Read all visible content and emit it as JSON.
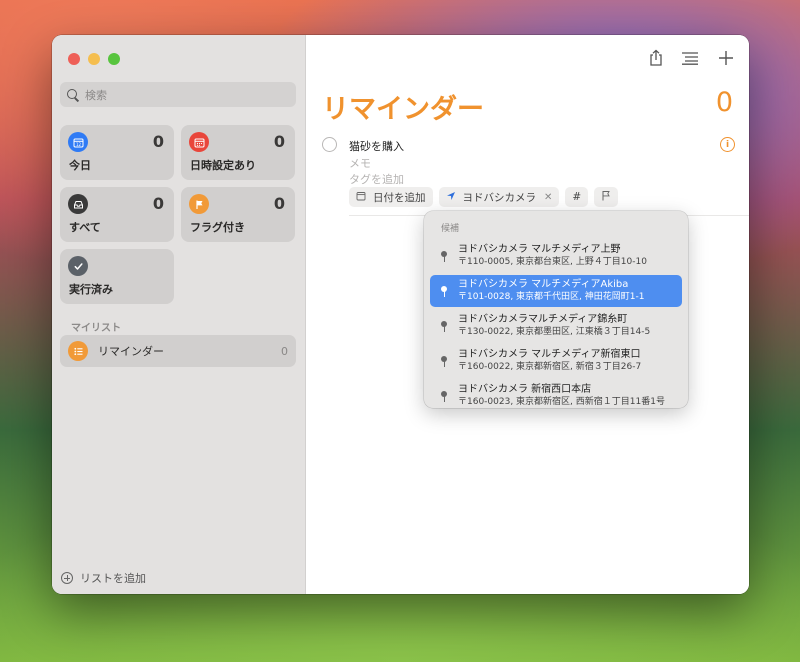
{
  "sidebar": {
    "search_placeholder": "検索",
    "tiles": [
      {
        "label": "今日",
        "count": "0",
        "icon": "calendar-today-icon",
        "color": "#2f7bf5"
      },
      {
        "label": "日時設定あり",
        "count": "0",
        "icon": "calendar-icon",
        "color": "#e9463b"
      },
      {
        "label": "すべて",
        "count": "0",
        "icon": "tray-icon",
        "color": "#3a3a3a"
      },
      {
        "label": "フラグ付き",
        "count": "0",
        "icon": "flag-icon",
        "color": "#f19a38"
      },
      {
        "label": "実行済み",
        "count": "",
        "icon": "checkmark-icon",
        "color": "#5b6168"
      }
    ],
    "section_title": "マイリスト",
    "lists": [
      {
        "name": "リマインダー",
        "count": "0",
        "icon": "list-bullet-icon",
        "color": "#f19a38"
      }
    ],
    "add_list_label": "リストを追加"
  },
  "main": {
    "title": "リマインダー",
    "count": "0",
    "accent_color": "#f0922e",
    "reminder": {
      "title": "猫砂を購入",
      "notes_placeholder": "メモ",
      "tags_placeholder": "タグを追加"
    },
    "chips": {
      "date": "日付を追加",
      "location": "ヨドバシカメラ",
      "tag": "#"
    }
  },
  "popup": {
    "header": "候補",
    "selected_index": 1,
    "selected_color": "#4e8ef0",
    "suggestions": [
      {
        "name": "ヨドバシカメラ マルチメディア上野",
        "address": "〒110-0005, 東京都台東区, 上野４丁目10-10"
      },
      {
        "name": "ヨドバシカメラ マルチメディアAkiba",
        "address": "〒101-0028, 東京都千代田区, 神田花岡町1-1"
      },
      {
        "name": "ヨドバシカメラマルチメディア錦糸町",
        "address": "〒130-0022, 東京都墨田区, 江東橋３丁目14-5"
      },
      {
        "name": "ヨドバシカメラ マルチメディア新宿東口",
        "address": "〒160-0022, 東京都新宿区, 新宿３丁目26-7"
      },
      {
        "name": "ヨドバシカメラ 新宿西口本店",
        "address": "〒160-0023, 東京都新宿区, 西新宿１丁目11番1号"
      }
    ]
  }
}
